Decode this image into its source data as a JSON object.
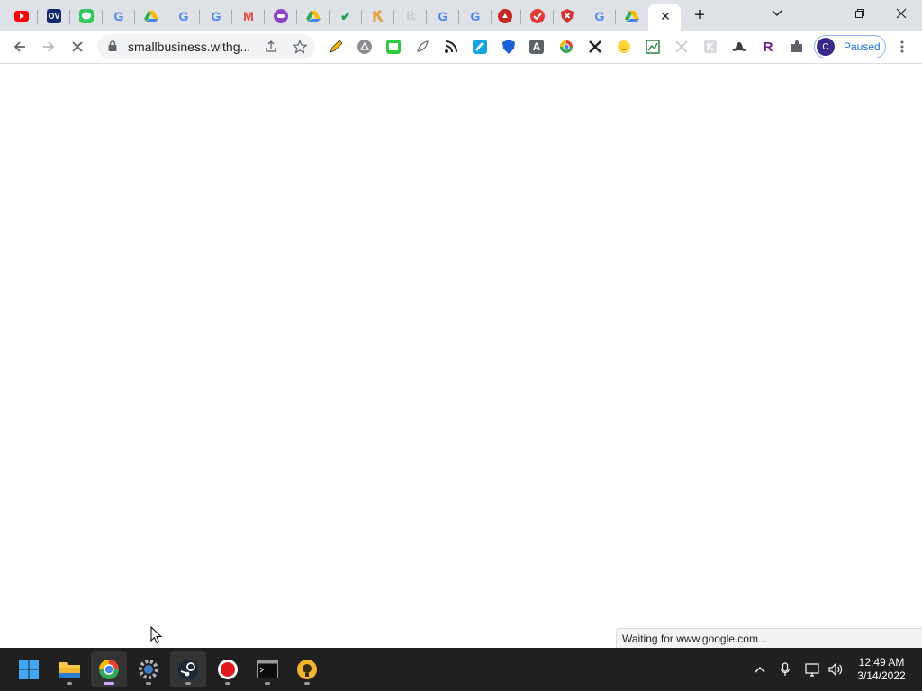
{
  "browser": {
    "tabs": [
      {
        "icon": "youtube-icon"
      },
      {
        "icon": "ov-icon",
        "text": "OV"
      },
      {
        "icon": "messages-icon"
      },
      {
        "icon": "google-icon",
        "text": "G"
      },
      {
        "icon": "drive-icon"
      },
      {
        "icon": "google-icon",
        "text": "G"
      },
      {
        "icon": "google-icon",
        "text": "G"
      },
      {
        "icon": "gmail-icon",
        "text": "M"
      },
      {
        "icon": "chat-icon"
      },
      {
        "icon": "drive-icon"
      },
      {
        "icon": "checkmark-icon",
        "text": "✔"
      },
      {
        "icon": "crown-icon"
      },
      {
        "icon": "r-icon",
        "text": "R"
      },
      {
        "icon": "google-icon",
        "text": "G"
      },
      {
        "icon": "google-icon",
        "text": "G"
      },
      {
        "icon": "hand-icon"
      },
      {
        "icon": "todoist-icon"
      },
      {
        "icon": "shield-icon"
      },
      {
        "icon": "google-icon",
        "text": "G"
      },
      {
        "icon": "drive-icon"
      },
      {
        "icon": "active-tab",
        "active": true
      }
    ],
    "close_tab_glyph": "✕",
    "new_tab_glyph": "+",
    "url": "smallbusiness.withg...",
    "profile": {
      "initial": "C",
      "label": "Paused"
    },
    "status_text": "Waiting for www.google.com..."
  },
  "taskbar": {
    "clock": {
      "time": "12:49 AM",
      "date": "3/14/2022"
    }
  }
}
